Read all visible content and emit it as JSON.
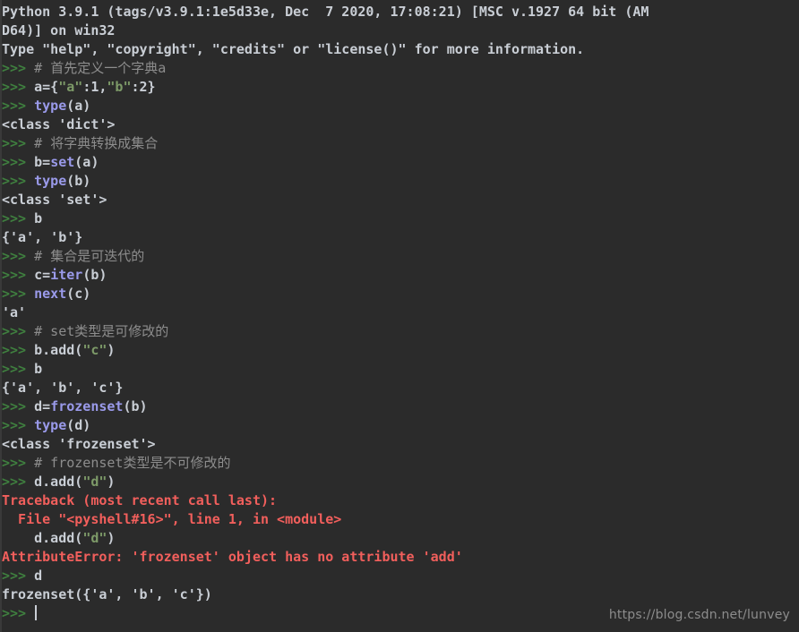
{
  "window": {
    "title": "Python 3.9.1 Shell",
    "background_color": "#2b2b2b"
  },
  "colors": {
    "background": "#2b2b2b",
    "plain_text": "#c9ced5",
    "prompt": "#3f7f3f",
    "builtin": "#9a9aea",
    "string": "#7d9a68",
    "comment": "#8d8d8d",
    "error": "#f25f5c",
    "watermark": "#8c8c8c"
  },
  "prompt": ">>>",
  "watermark": "https://blog.csdn.net/lunvey",
  "cursor": {
    "visible": true,
    "line_index": 30
  },
  "lines": [
    {
      "id": "banner-1",
      "kind": "output",
      "tokens": [
        {
          "c": "plain",
          "t": "Python 3.9.1 (tags/v3.9.1:1e5d33e, Dec  7 2020, 17:08:21) [MSC v.1927 64 bit (AM"
        }
      ]
    },
    {
      "id": "banner-2",
      "kind": "output",
      "tokens": [
        {
          "c": "plain",
          "t": "D64)] on win32"
        }
      ]
    },
    {
      "id": "banner-3",
      "kind": "output",
      "tokens": [
        {
          "c": "plain",
          "t": "Type \"help\", \"copyright\", \"credits\" or \"license()\" for more information."
        }
      ]
    },
    {
      "id": "in-comment-1",
      "kind": "input",
      "tokens": [
        {
          "c": "prompt",
          "t": ">>>"
        },
        {
          "c": "plain",
          "t": " "
        },
        {
          "c": "comment",
          "t": "# "
        },
        {
          "c": "comment-cjk",
          "t": "首先定义一个字典a"
        }
      ]
    },
    {
      "id": "in-dict",
      "kind": "input",
      "tokens": [
        {
          "c": "prompt",
          "t": ">>>"
        },
        {
          "c": "plain",
          "t": " a={"
        },
        {
          "c": "string",
          "t": "\"a\""
        },
        {
          "c": "plain",
          "t": ":1,"
        },
        {
          "c": "string",
          "t": "\"b\""
        },
        {
          "c": "plain",
          "t": ":2}"
        }
      ]
    },
    {
      "id": "in-type-a",
      "kind": "input",
      "tokens": [
        {
          "c": "prompt",
          "t": ">>>"
        },
        {
          "c": "plain",
          "t": " "
        },
        {
          "c": "builtin",
          "t": "type"
        },
        {
          "c": "plain",
          "t": "(a)"
        }
      ]
    },
    {
      "id": "out-dict",
      "kind": "output",
      "tokens": [
        {
          "c": "plain",
          "t": "<class 'dict'>"
        }
      ]
    },
    {
      "id": "in-comment-2",
      "kind": "input",
      "tokens": [
        {
          "c": "prompt",
          "t": ">>>"
        },
        {
          "c": "plain",
          "t": " "
        },
        {
          "c": "comment",
          "t": "# "
        },
        {
          "c": "comment-cjk",
          "t": "将字典转换成集合"
        }
      ]
    },
    {
      "id": "in-bset",
      "kind": "input",
      "tokens": [
        {
          "c": "prompt",
          "t": ">>>"
        },
        {
          "c": "plain",
          "t": " b="
        },
        {
          "c": "builtin",
          "t": "set"
        },
        {
          "c": "plain",
          "t": "(a)"
        }
      ]
    },
    {
      "id": "in-type-b",
      "kind": "input",
      "tokens": [
        {
          "c": "prompt",
          "t": ">>>"
        },
        {
          "c": "plain",
          "t": " "
        },
        {
          "c": "builtin",
          "t": "type"
        },
        {
          "c": "plain",
          "t": "(b)"
        }
      ]
    },
    {
      "id": "out-set",
      "kind": "output",
      "tokens": [
        {
          "c": "plain",
          "t": "<class 'set'>"
        }
      ]
    },
    {
      "id": "in-b-1",
      "kind": "input",
      "tokens": [
        {
          "c": "prompt",
          "t": ">>>"
        },
        {
          "c": "plain",
          "t": " b"
        }
      ]
    },
    {
      "id": "out-ab",
      "kind": "output",
      "tokens": [
        {
          "c": "plain",
          "t": "{'a', 'b'}"
        }
      ]
    },
    {
      "id": "in-comment-3",
      "kind": "input",
      "tokens": [
        {
          "c": "prompt",
          "t": ">>>"
        },
        {
          "c": "plain",
          "t": " "
        },
        {
          "c": "comment",
          "t": "# "
        },
        {
          "c": "comment-cjk",
          "t": "集合是可迭代的"
        }
      ]
    },
    {
      "id": "in-iter",
      "kind": "input",
      "tokens": [
        {
          "c": "prompt",
          "t": ">>>"
        },
        {
          "c": "plain",
          "t": " c="
        },
        {
          "c": "builtin",
          "t": "iter"
        },
        {
          "c": "plain",
          "t": "(b)"
        }
      ]
    },
    {
      "id": "in-next",
      "kind": "input",
      "tokens": [
        {
          "c": "prompt",
          "t": ">>>"
        },
        {
          "c": "plain",
          "t": " "
        },
        {
          "c": "builtin",
          "t": "next"
        },
        {
          "c": "plain",
          "t": "(c)"
        }
      ]
    },
    {
      "id": "out-a",
      "kind": "output",
      "tokens": [
        {
          "c": "plain",
          "t": "'a'"
        }
      ]
    },
    {
      "id": "in-comment-4",
      "kind": "input",
      "tokens": [
        {
          "c": "prompt",
          "t": ">>>"
        },
        {
          "c": "plain",
          "t": " "
        },
        {
          "c": "comment",
          "t": "# set"
        },
        {
          "c": "comment-cjk",
          "t": "类型是可修改的"
        }
      ]
    },
    {
      "id": "in-badd",
      "kind": "input",
      "tokens": [
        {
          "c": "prompt",
          "t": ">>>"
        },
        {
          "c": "plain",
          "t": " b.add("
        },
        {
          "c": "string",
          "t": "\"c\""
        },
        {
          "c": "plain",
          "t": ")"
        }
      ]
    },
    {
      "id": "in-b-2",
      "kind": "input",
      "tokens": [
        {
          "c": "prompt",
          "t": ">>>"
        },
        {
          "c": "plain",
          "t": " b"
        }
      ]
    },
    {
      "id": "out-abc",
      "kind": "output",
      "tokens": [
        {
          "c": "plain",
          "t": "{'a', 'b', 'c'}"
        }
      ]
    },
    {
      "id": "in-frozen",
      "kind": "input",
      "tokens": [
        {
          "c": "prompt",
          "t": ">>>"
        },
        {
          "c": "plain",
          "t": " d="
        },
        {
          "c": "builtin",
          "t": "frozenset"
        },
        {
          "c": "plain",
          "t": "(b)"
        }
      ]
    },
    {
      "id": "in-type-d",
      "kind": "input",
      "tokens": [
        {
          "c": "prompt",
          "t": ">>>"
        },
        {
          "c": "plain",
          "t": " "
        },
        {
          "c": "builtin",
          "t": "type"
        },
        {
          "c": "plain",
          "t": "(d)"
        }
      ]
    },
    {
      "id": "out-frozen",
      "kind": "output",
      "tokens": [
        {
          "c": "plain",
          "t": "<class 'frozenset'>"
        }
      ]
    },
    {
      "id": "in-comment-5",
      "kind": "input",
      "tokens": [
        {
          "c": "prompt",
          "t": ">>>"
        },
        {
          "c": "plain",
          "t": " "
        },
        {
          "c": "comment",
          "t": "# frozenset"
        },
        {
          "c": "comment-cjk",
          "t": "类型是不可修改的"
        }
      ]
    },
    {
      "id": "in-dadd",
      "kind": "input",
      "tokens": [
        {
          "c": "prompt",
          "t": ">>>"
        },
        {
          "c": "plain",
          "t": " d.add("
        },
        {
          "c": "string",
          "t": "\"d\""
        },
        {
          "c": "plain",
          "t": ")"
        }
      ]
    },
    {
      "id": "err-header",
      "kind": "error",
      "tokens": [
        {
          "c": "error",
          "t": "Traceback (most recent call last):"
        }
      ]
    },
    {
      "id": "err-file",
      "kind": "error",
      "tokens": [
        {
          "c": "error",
          "t": "  File \"<pyshell#16>\", line 1, in <module>"
        }
      ]
    },
    {
      "id": "err-source",
      "kind": "error",
      "tokens": [
        {
          "c": "plain",
          "t": "    d.add("
        },
        {
          "c": "string",
          "t": "\"d\""
        },
        {
          "c": "plain",
          "t": ")"
        }
      ]
    },
    {
      "id": "err-message",
      "kind": "error",
      "tokens": [
        {
          "c": "error",
          "t": "AttributeError: 'frozenset' object has no attribute 'add'"
        }
      ]
    },
    {
      "id": "in-d",
      "kind": "input",
      "tokens": [
        {
          "c": "prompt",
          "t": ">>>"
        },
        {
          "c": "plain",
          "t": " d"
        }
      ]
    },
    {
      "id": "out-frozenval",
      "kind": "output",
      "tokens": [
        {
          "c": "plain",
          "t": "frozenset({'a', 'b', 'c'})"
        }
      ]
    },
    {
      "id": "in-cursor",
      "kind": "input",
      "tokens": [
        {
          "c": "prompt",
          "t": ">>>"
        },
        {
          "c": "plain",
          "t": " "
        }
      ],
      "cursor": true
    }
  ]
}
